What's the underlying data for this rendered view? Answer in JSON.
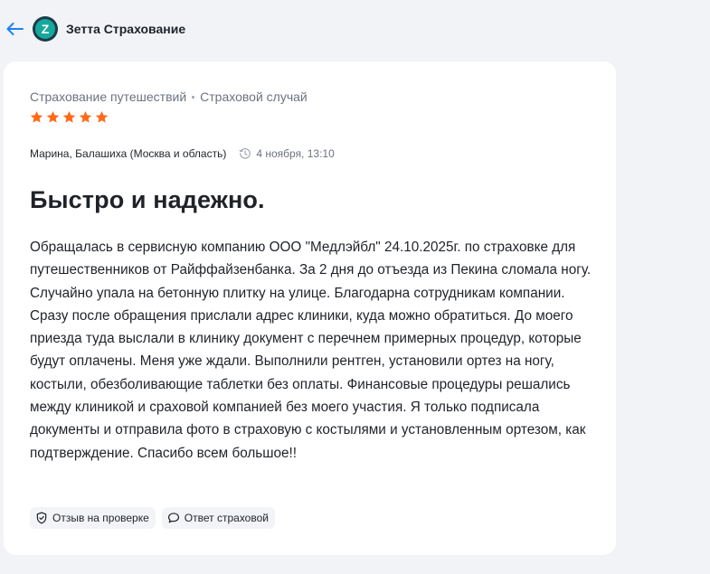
{
  "header": {
    "company_name": "Зетта Страхование",
    "logo_letter": "Z",
    "back_icon": "arrow-left-icon"
  },
  "colors": {
    "accent_blue": "#1a82f5",
    "star_orange": "#ff6a1a",
    "logo_teal": "#16a89b",
    "logo_dark": "#1d3a4a"
  },
  "review": {
    "breadcrumb": [
      "Страхование путешествий",
      "Страховой случай"
    ],
    "rating": 5,
    "rating_max": 5,
    "author": "Марина, Балашиха (Москва и область)",
    "date": "4 ноября, 13:10",
    "title": "Быстро и надежно.",
    "body": "Обращалась в сервисную компанию ООО \"Медлэйбл\" 24.10.2025г. по страховке для путешественников от Райффайзенбанка. За 2 дня до отъезда из Пекина сломала ногу. Случайно упала на бетонную плитку на улице. Благодарна сотрудникам компании. Сразу после обращения прислали адрес клиники, куда можно обратиться. До моего приезда туда выслали в клинику документ с перечнем примерных процедур, которые будут оплачены. Меня уже ждали. Выполнили рентген, установили ортез на ногу, костыли, обезболивающие таблетки без оплаты. Финансовые процедуры решались между клиникой и сраховой компанией без моего участия. Я только подписала документы и отправила фото в страховую с костылями и установленным ортезом, как подтверждение. Спасибо всем большое!!",
    "tags": [
      {
        "label": "Отзыв на проверке",
        "icon": "shield-check-icon"
      },
      {
        "label": "Ответ страховой",
        "icon": "chat-bubble-icon"
      }
    ]
  }
}
